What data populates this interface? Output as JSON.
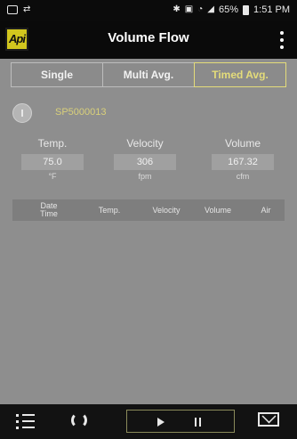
{
  "status_bar": {
    "battery_percent": "65%",
    "time": "1:51 PM"
  },
  "app_bar": {
    "logo_text": "Api",
    "title": "Volume Flow"
  },
  "tabs": [
    {
      "label": "Single",
      "active": false
    },
    {
      "label": "Multi Avg.",
      "active": false
    },
    {
      "label": "Timed Avg.",
      "active": true
    }
  ],
  "sensor": {
    "label": "SP5000013"
  },
  "measurements": [
    {
      "label": "Temp.",
      "value": "75.0",
      "unit": "°F"
    },
    {
      "label": "Velocity",
      "value": "306",
      "unit": "fpm"
    },
    {
      "label": "Volume",
      "value": "167.32",
      "unit": "cfm"
    }
  ],
  "table": {
    "headers": [
      "Date\nTime",
      "Temp.",
      "Velocity",
      "Volume",
      "Air"
    ]
  },
  "colors": {
    "accent": "#e4dc7a",
    "background": "#8e8e8e",
    "bar": "#0a0a0a"
  }
}
